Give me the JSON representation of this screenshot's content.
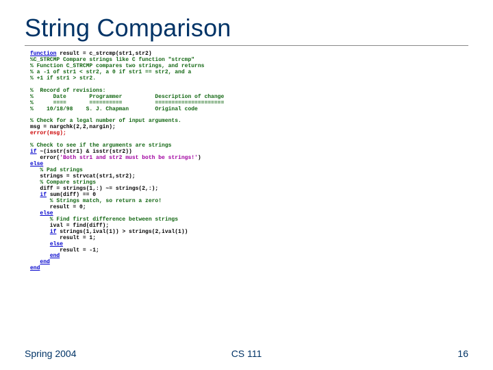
{
  "title": "String Comparison",
  "footer": {
    "left": "Spring 2004",
    "center": "CS 111",
    "right": "16"
  },
  "kw": {
    "function": "function",
    "if": "if",
    "else": "else",
    "end": "end"
  },
  "code": {
    "l01a": " result = c_strcmp(str1,str2)",
    "l02": "%C_STRCMP Compare strings like C function \"strcmp\"",
    "l03": "% Function C_STRCMP compares two strings, and returns",
    "l04": "% a -1 of str1 < str2, a 0 if str1 == str2, and a",
    "l05": "% +1 if str1 > str2.",
    "blk": " ",
    "l06": "%  Record of revisions:",
    "l07": "%      Date       Programmer          Description of change",
    "l08": "%      ====       ==========          =====================",
    "l09": "%    10/18/98    S. J. Chapman        Original code",
    "l10": "% Check for a legal number of input arguments.",
    "l11": "msg = nargchk(2,2,nargin);",
    "l12": "error(msg);",
    "l13": "% Check to see if the arguments are strings",
    "l14a": " ~(isstr(str1) & isstr(str2))",
    "l15a": "   error(",
    "l15s": "'Both str1 and str2 must both be strings!'",
    "l15c": ")",
    "l17": "   % Pad strings",
    "l18": "   strings = strvcat(str1,str2);",
    "l19": "   % Compare strings",
    "l20": "   diff = strings(1,:) ~= strings(2,:);",
    "l21a": " sum(diff) == 0",
    "l22": "      % Strings match, so return a zero!",
    "l23": "      result = 0;",
    "l25": "      % Find first difference between strings",
    "l26": "      ival = find(diff);",
    "l27a": " strings(1,ival(1)) > strings(2,ival(1))",
    "l28": "         result = 1;",
    "l30": "         result = -1;",
    "pad3": "   ",
    "pad6": "      ",
    "pad9": "         "
  }
}
